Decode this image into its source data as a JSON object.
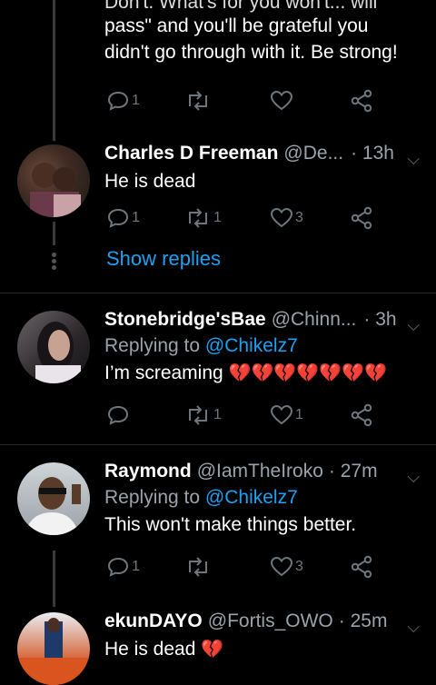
{
  "partial_tweet": {
    "cut_line": "Don't. What's for you won't... will",
    "line1": "pass\" and you'll be grateful you",
    "line2": "didn't go through with it. Be strong!",
    "reply_count": "1",
    "retweet_count": "",
    "like_count": ""
  },
  "tweets": [
    {
      "name": "Charles D Freeman",
      "handle": "@De...",
      "time": "· 13h",
      "replying_prefix": "",
      "replying_mention": "",
      "text": "He is dead",
      "reply_count": "1",
      "retweet_count": "1",
      "like_count": "3"
    },
    {
      "name": "Stonebridge'sBae",
      "handle": "@Chinn...",
      "time": "· 3h",
      "replying_prefix": "Replying to ",
      "replying_mention": "@Chikelz7",
      "text": "I’m screaming",
      "emoji": "💔💔💔💔💔💔💔",
      "reply_count": "",
      "retweet_count": "1",
      "like_count": "1"
    },
    {
      "name": "Raymond",
      "handle": "@IamTheIroko",
      "time": "· 27m",
      "replying_prefix": "Replying to ",
      "replying_mention": "@Chikelz7",
      "text": "This won't make things better.",
      "reply_count": "1",
      "retweet_count": "",
      "like_count": "3"
    },
    {
      "name": "ekunDAYO",
      "handle": "@Fortis_OWO",
      "time": "· 25m",
      "replying_prefix": "",
      "replying_mention": "",
      "text": "He is dead",
      "emoji": "💔"
    }
  ],
  "show_replies_label": "Show replies",
  "colors": {
    "background": "#000000",
    "link": "#1da1f2",
    "muted": "#9aa3ab",
    "heart": "#e0245e"
  }
}
